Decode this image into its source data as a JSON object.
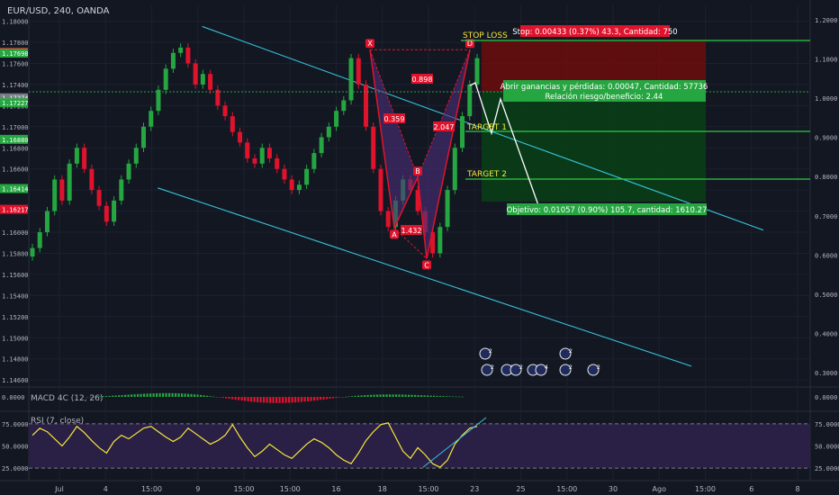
{
  "header": {
    "symbol": "EUR/USD, 240, OANDA",
    "macd_title": "MACD 4C (12, 26)",
    "rsi_title": "RSI (7, close)"
  },
  "colors": {
    "background": "#131722",
    "up": "#26a641",
    "down": "#e0132d",
    "channel": "#35c2d8",
    "pattern": "#e0132d",
    "pattern_fill": "#4b2f7a",
    "target": "#2ecc40",
    "stop_zone": "#6d0d0d",
    "profit_zone": "#0a3d17",
    "rsi_line": "#f5e93a",
    "rsi_band": "#2a1f45",
    "sl_label": "#f5e93a"
  },
  "price_axis_left": {
    "ticks": [
      "1.18000",
      "1.17800",
      "1.17600",
      "1.17400",
      "1.17200",
      "1.17000",
      "1.16800",
      "1.16600",
      "1.16400",
      "1.16200",
      "1.16000",
      "1.15800",
      "1.15600",
      "1.15400",
      "1.15200",
      "1.15000",
      "1.14800",
      "1.14600"
    ],
    "highlights": [
      {
        "text": "1.17707",
        "color": "#e0132d"
      },
      {
        "text": "1.17698",
        "color": "#26a641"
      },
      {
        "text": "1.17274",
        "color": "#787b86"
      },
      {
        "text": "1.17227",
        "color": "#26a641"
      },
      {
        "text": "1.16880",
        "color": "#26a641"
      },
      {
        "text": "1.16414",
        "color": "#26a641"
      },
      {
        "text": "1.16217",
        "color": "#e0132d"
      }
    ]
  },
  "price_axis_right": {
    "ticks": [
      "1.2000",
      "1.1000",
      "1.0000",
      "0.9000",
      "0.8000",
      "0.7000",
      "0.6000",
      "0.5000",
      "0.4000",
      "0.3000"
    ]
  },
  "macd_axis": {
    "left": "0.0000",
    "right": "0.0000"
  },
  "rsi_axis": {
    "left": [
      "75.0000",
      "50.0000",
      "25.0000"
    ],
    "right": [
      "75.0000",
      "50.0000",
      "25.0000"
    ]
  },
  "time_axis": {
    "labels": [
      "Jul",
      "4",
      "15:00",
      "9",
      "15:00",
      "15:00",
      "16",
      "18",
      "15:00",
      "23",
      "25",
      "15:00",
      "30",
      "Ago",
      "15:00",
      "6",
      "8"
    ]
  },
  "pattern": {
    "points": [
      {
        "label": "X",
        "price": 1.1773
      },
      {
        "label": "A",
        "price": 1.1604
      },
      {
        "label": "B",
        "price": 1.1652
      },
      {
        "label": "C",
        "price": 1.1575
      },
      {
        "label": "D",
        "price": 1.1773
      }
    ],
    "ratios": [
      "0.898",
      "0.359",
      "2.047",
      "1.432"
    ]
  },
  "trade": {
    "stop_label": "STOP LOSS",
    "target1_label": "TARGET 1",
    "target2_label": "TARGET 2",
    "stop_box": "Stop: 0.00433 (0.37%) 43.3, Cantidad: 750",
    "open_pnl": "Abrir ganancias y pérdidas: 0.00047, Cantidad: 57736",
    "risk_reward": "Relación riesgo/beneficio: 2.44",
    "objective": "Objetivo: 0.01057 (0.90%) 105.7, cantidad: 1610.27"
  },
  "events": [
    {
      "text": "2"
    },
    {
      "text": "2"
    },
    {
      "text": "2"
    },
    {
      "text": "2"
    },
    {
      "text": "3"
    },
    {
      "text": "4"
    },
    {
      "text": "2"
    },
    {
      "text": "2"
    },
    {
      "text": "2"
    }
  ],
  "chart_data": {
    "type": "candlestick",
    "title": "EUR/USD, 240, OANDA",
    "ylim": [
      1.1455,
      1.1815
    ],
    "x": [
      "Jul",
      "4",
      "9",
      "16",
      "18",
      "23",
      "25",
      "30",
      "Ago",
      "6",
      "8"
    ],
    "close_series": [
      1.1585,
      1.16,
      1.162,
      1.165,
      1.163,
      1.1665,
      1.168,
      1.166,
      1.164,
      1.1625,
      1.161,
      1.163,
      1.165,
      1.1665,
      1.168,
      1.17,
      1.1715,
      1.1735,
      1.1755,
      1.177,
      1.1775,
      1.176,
      1.174,
      1.175,
      1.1735,
      1.172,
      1.171,
      1.1695,
      1.1685,
      1.167,
      1.1665,
      1.168,
      1.167,
      1.166,
      1.165,
      1.164,
      1.1645,
      1.166,
      1.1675,
      1.169,
      1.17,
      1.1715,
      1.1725,
      1.1765,
      1.174,
      1.17,
      1.166,
      1.162,
      1.1605,
      1.163,
      1.165,
      1.164,
      1.162,
      1.16,
      1.158,
      1.1605,
      1.164,
      1.168,
      1.171,
      1.174,
      1.1765
    ],
    "rsi": [
      62,
      70,
      66,
      58,
      50,
      60,
      72,
      65,
      56,
      48,
      42,
      55,
      62,
      58,
      64,
      70,
      72,
      66,
      60,
      55,
      60,
      70,
      64,
      58,
      52,
      56,
      62,
      74,
      60,
      48,
      38,
      44,
      52,
      46,
      40,
      36,
      44,
      52,
      58,
      54,
      48,
      40,
      34,
      30,
      42,
      56,
      66,
      74,
      76,
      60,
      44,
      36,
      48,
      40,
      30,
      26,
      34,
      52,
      62,
      70,
      72
    ],
    "channel_upper": [
      [
        0.222,
        1.1795
      ],
      [
        0.94,
        1.1602
      ]
    ],
    "channel_lower": [
      [
        0.165,
        1.1642
      ],
      [
        0.848,
        1.1473
      ]
    ],
    "rsi_levels": [
      75,
      25
    ]
  }
}
